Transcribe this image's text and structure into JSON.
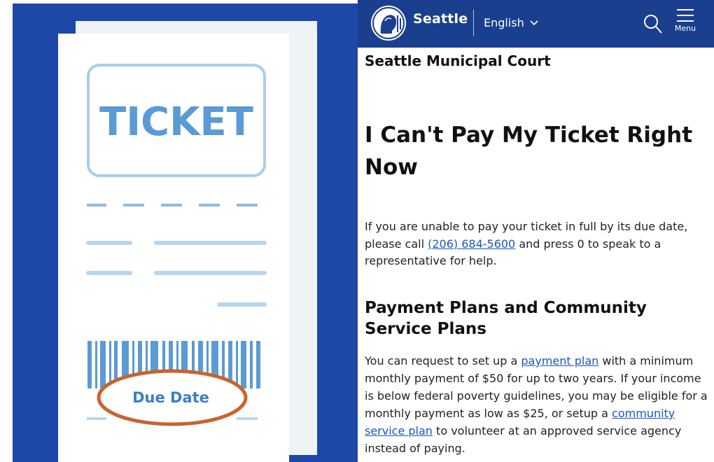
{
  "illustration": {
    "ticket_title": "TICKET",
    "due_label": "Due Date",
    "colors": {
      "background": "#1d48a8",
      "paper": "#ffffff",
      "accent_blue": "#5b9bd5",
      "light_blue": "#b7d6ef",
      "circle_orange": "#c9632e"
    }
  },
  "header": {
    "brand": "Seattle",
    "language": "English",
    "language_icon": "chevron-down-icon",
    "search_icon": "search-icon",
    "menu_icon": "hamburger-icon",
    "menu_label": "Menu",
    "bar_color": "#1a3f8f"
  },
  "breadcrumb": "Seattle Municipal Court",
  "page_title": "I Can't Pay My Ticket Right Now",
  "intro": {
    "text_before": "If you are unable to pay your ticket in full by its due date, please call ",
    "phone_link": "(206) 684-5600",
    "text_after": " and press 0 to speak to a representative for help."
  },
  "payment_section": {
    "title": "Payment Plans and Community Service Plans",
    "text_1": "You can request to set up a ",
    "link_payment_plan": "payment plan",
    "text_2": " with a minimum monthly payment of $50 for up to two years. If your income is below federal poverty guidelines, you may be eligible for a monthly payment as low as $25, or setup a ",
    "link_community_service": "community service plan",
    "text_3": " to volunteer at an approved service agency instead of paying."
  },
  "link_color": "#1a56c4"
}
